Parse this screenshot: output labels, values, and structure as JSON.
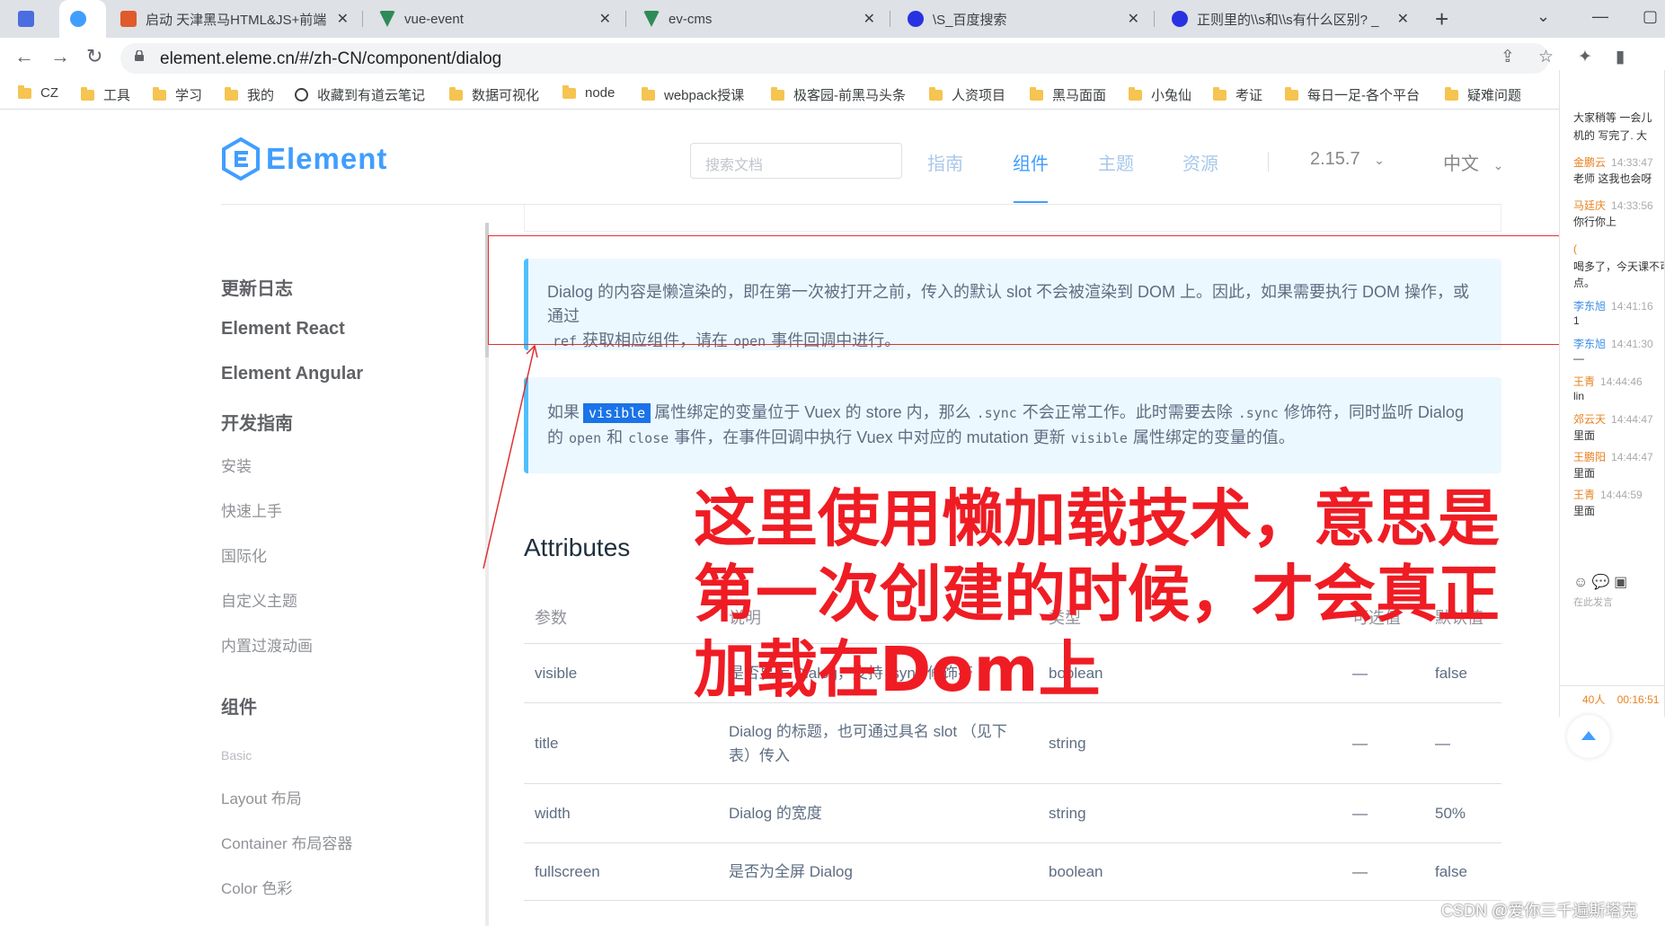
{
  "browser": {
    "tabs": [
      {
        "label": "",
        "icon": "figma-icon",
        "color": "#4a6ee0"
      },
      {
        "label": "",
        "icon": "element-icon",
        "color": "#409eff",
        "active": true
      },
      {
        "label": "启动 天津黑马HTML&JS+前端",
        "icon": "video-icon",
        "color": "#e05a2a"
      },
      {
        "label": "vue-event",
        "icon": "vue-icon",
        "color": "#2e8b57"
      },
      {
        "label": "ev-cms",
        "icon": "vue-icon",
        "color": "#2e8b57"
      },
      {
        "label": "\\S_百度搜索",
        "icon": "baidu-icon",
        "color": "#2932e1"
      },
      {
        "label": "正则里的\\\\s和\\\\s有什么区别? _",
        "icon": "baidu-icon",
        "color": "#2932e1"
      }
    ],
    "url": "element.eleme.cn/#/zh-CN/component/dialog",
    "bookmarks": [
      {
        "label": "CZ",
        "type": "folder"
      },
      {
        "label": "工具",
        "type": "folder"
      },
      {
        "label": "学习",
        "type": "folder"
      },
      {
        "label": "我的",
        "type": "folder"
      },
      {
        "label": "收藏到有道云笔记",
        "type": "globe"
      },
      {
        "label": "数据可视化",
        "type": "folder"
      },
      {
        "label": "node",
        "type": "folder"
      },
      {
        "label": "webpack授课",
        "type": "folder"
      },
      {
        "label": "极客园-前黑马头条",
        "type": "folder"
      },
      {
        "label": "人资项目",
        "type": "folder"
      },
      {
        "label": "黑马面面",
        "type": "folder"
      },
      {
        "label": "小兔仙",
        "type": "folder"
      },
      {
        "label": "考证",
        "type": "folder"
      },
      {
        "label": "每日一足-各个平台",
        "type": "folder"
      },
      {
        "label": "疑难问题",
        "type": "folder"
      }
    ]
  },
  "site": {
    "logo_text": "Element",
    "search_placeholder": "搜索文档",
    "nav": [
      "指南",
      "组件",
      "主题",
      "资源"
    ],
    "version": "2.15.7",
    "language": "中文",
    "brand_color": "#409eff"
  },
  "sidebar": {
    "items": [
      {
        "label": "更新日志",
        "style": "major"
      },
      {
        "label": "Element React",
        "style": "major"
      },
      {
        "label": "Element Angular",
        "style": "major"
      },
      {
        "label": "开发指南",
        "style": "major"
      },
      {
        "label": "安装",
        "style": "minor"
      },
      {
        "label": "快速上手",
        "style": "minor"
      },
      {
        "label": "国际化",
        "style": "minor"
      },
      {
        "label": "自定义主题",
        "style": "minor"
      },
      {
        "label": "内置过渡动画",
        "style": "minor"
      },
      {
        "label": "组件",
        "style": "major"
      },
      {
        "label": "Basic",
        "style": "tiny"
      },
      {
        "label": "Layout 布局",
        "style": "minor"
      },
      {
        "label": "Container 布局容器",
        "style": "minor"
      },
      {
        "label": "Color 色彩",
        "style": "minor"
      }
    ]
  },
  "content": {
    "tip1": {
      "line1": "Dialog 的内容是懒渲染的，即在第一次被打开之前，传入的默认 slot 不会被渲染到 DOM 上。因此，如果需要执行 DOM 操作，或通过",
      "code_ref": "ref",
      "mid": "获取相应组件，请在",
      "code_open": "open",
      "end": "事件回调中进行。"
    },
    "tip2": {
      "prefix": "如果",
      "code_visible": "visible",
      "p1": "属性绑定的变量位于 Vuex 的 store 内，那么",
      "code_sync": ".sync",
      "p2": "不会正常工作。此时需要去除",
      "code_sync2": ".sync",
      "p3": "修饰符，同时监听 Dialog",
      "p4": "的",
      "code_open": "open",
      "p5": "和",
      "code_close": "close",
      "p6": "事件，在事件回调中执行 Vuex 中对应的 mutation 更新",
      "code_visible2": "visible",
      "p7": "属性绑定的变量的值。"
    },
    "attributes_title": "Attributes",
    "table": {
      "headers": [
        "参数",
        "说明",
        "类型",
        "可选值",
        "默认值"
      ],
      "rows": [
        [
          "visible",
          "是否显示 Dialog，支持 .sync 修饰符",
          "boolean",
          "—",
          "false"
        ],
        [
          "title",
          "Dialog 的标题，也可通过具名 slot （见下表）传入",
          "string",
          "—",
          "—"
        ],
        [
          "width",
          "Dialog 的宽度",
          "string",
          "—",
          "50%"
        ],
        [
          "fullscreen",
          "是否为全屏 Dialog",
          "boolean",
          "—",
          "false"
        ]
      ]
    }
  },
  "annotation": {
    "line1": "这里使用懒加载技术，意思是",
    "line2": "第一次创建的时候，才会真正",
    "line3": "加载在Dom上"
  },
  "chat": {
    "messages": [
      {
        "name": "",
        "time": "",
        "text": "大家稍等 一会儿"
      },
      {
        "name": "",
        "time": "",
        "text": "机的 写完了. 大"
      },
      {
        "name": "金鹏云",
        "time": "14:33:47",
        "text": "老师 这我也会呀"
      },
      {
        "name": "马廷庆",
        "time": "14:33:56",
        "text": "你行你上"
      },
      {
        "name": "(",
        "time": "",
        "text": "喝多了，今天课不可"
      },
      {
        "name": "",
        "time": "",
        "text": "点。"
      },
      {
        "name": "李东旭",
        "time": "14:41:16",
        "text": "1"
      },
      {
        "name": "李东旭",
        "time": "14:41:30",
        "text": "—"
      },
      {
        "name": "王青",
        "time": "14:44:46",
        "text": "lin"
      },
      {
        "name": "郊云天",
        "time": "14:44:47",
        "text": "里面"
      },
      {
        "name": "王鹏阳",
        "time": "14:44:47",
        "text": "里面"
      },
      {
        "name": "王青",
        "time": "14:44:59",
        "text": "里面"
      }
    ],
    "input_placeholder": "在此发言",
    "viewers": "40人",
    "elapsed": "00:16:51"
  },
  "watermark": "CSDN @爱你三千遍斯塔克"
}
